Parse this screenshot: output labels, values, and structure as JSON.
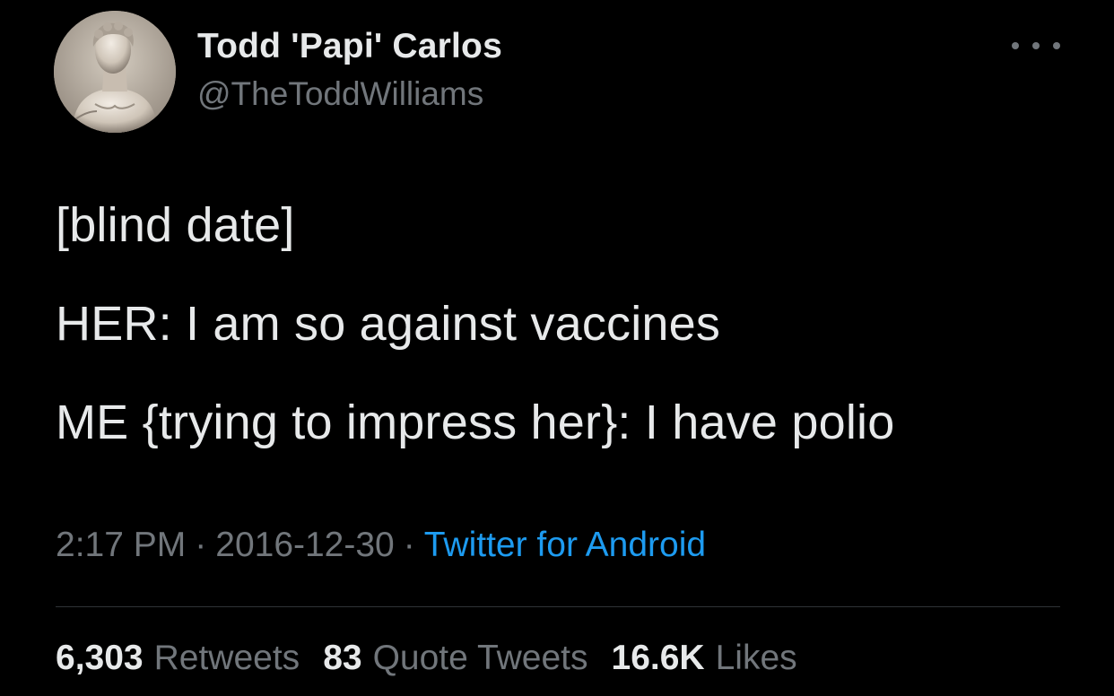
{
  "author": {
    "display_name": "Todd 'Papi' Carlos",
    "handle": "@TheToddWilliams",
    "avatar_icon": "marble-statue-avatar"
  },
  "menu": {
    "more_icon": "ellipsis-icon"
  },
  "tweet": {
    "lines": [
      "[blind date]",
      "HER: I am so against vaccines",
      "ME {trying to impress her}: I have polio"
    ]
  },
  "meta": {
    "time": "2:17 PM",
    "separator": "·",
    "date": "2016-12-30",
    "source": "Twitter for Android"
  },
  "stats": {
    "retweets": {
      "count": "6,303",
      "label": "Retweets"
    },
    "quotes": {
      "count": "83",
      "label": "Quote Tweets"
    },
    "likes": {
      "count": "16.6K",
      "label": "Likes"
    }
  },
  "colors": {
    "background": "#000000",
    "primary_text": "#e7e9ea",
    "secondary_text": "#71767b",
    "link": "#1d9bf0",
    "divider": "#2f3336"
  }
}
